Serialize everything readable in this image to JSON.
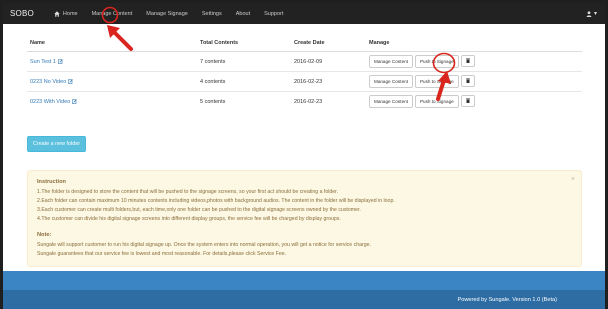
{
  "navbar": {
    "brand": "SOBO",
    "items": [
      {
        "label": "Home",
        "icon": "home-icon"
      },
      {
        "label": "Manage Content"
      },
      {
        "label": "Manage Signage"
      },
      {
        "label": "Settings"
      },
      {
        "label": "About"
      },
      {
        "label": "Support"
      }
    ],
    "user_icon": "user-icon"
  },
  "table": {
    "headers": [
      "Name",
      "Total Contents",
      "Create Date",
      "Manage"
    ],
    "rows": [
      {
        "name": "Sun Test 1",
        "contents": "7 contents",
        "date": "2016-02-09"
      },
      {
        "name": "0223 No Video",
        "contents": "4 contents",
        "date": "2016-02-23"
      },
      {
        "name": "0223 With Video",
        "contents": "5 contents",
        "date": "2016-02-23"
      }
    ],
    "buttons": {
      "manage": "Manage Content",
      "push": "Push to Signage",
      "delete_icon": "trash-icon"
    }
  },
  "create_button": "Create a new folder",
  "instruction": {
    "title": "Instruction",
    "close": "×",
    "lines": [
      "1.The folder is designed to store the content that will be pushed to the signage screens, so your first act should be creating a folder.",
      "2.Each folder can contain maximum 10 minutes contents including videos,photos with background audios. The content in the folder will be displayed in loop.",
      "3.Each customer can create multi folders,but, each time,only one folder can be pushed to the digital signage screens owned by the customer.",
      "4.The customer can divide his digital signage screens into different display groups, the service fee will be charged by display groups."
    ],
    "note_title": "Note:",
    "note_lines": [
      "Sungale will support customer to run his digital signage up. Once the system enters into normal operation, you will get a notice for service charge.",
      "Sungale guarantees that our service fee is lowest and most reasonable. For details,please click Service Fee."
    ]
  },
  "footer": "Powered by Sungale. Version 1.0 (Beta)",
  "colors": {
    "navbar": "#222222",
    "link": "#337ab7",
    "accent": "#5bc0de",
    "footer": "#2e6da4",
    "annotation": "#d9251d"
  }
}
